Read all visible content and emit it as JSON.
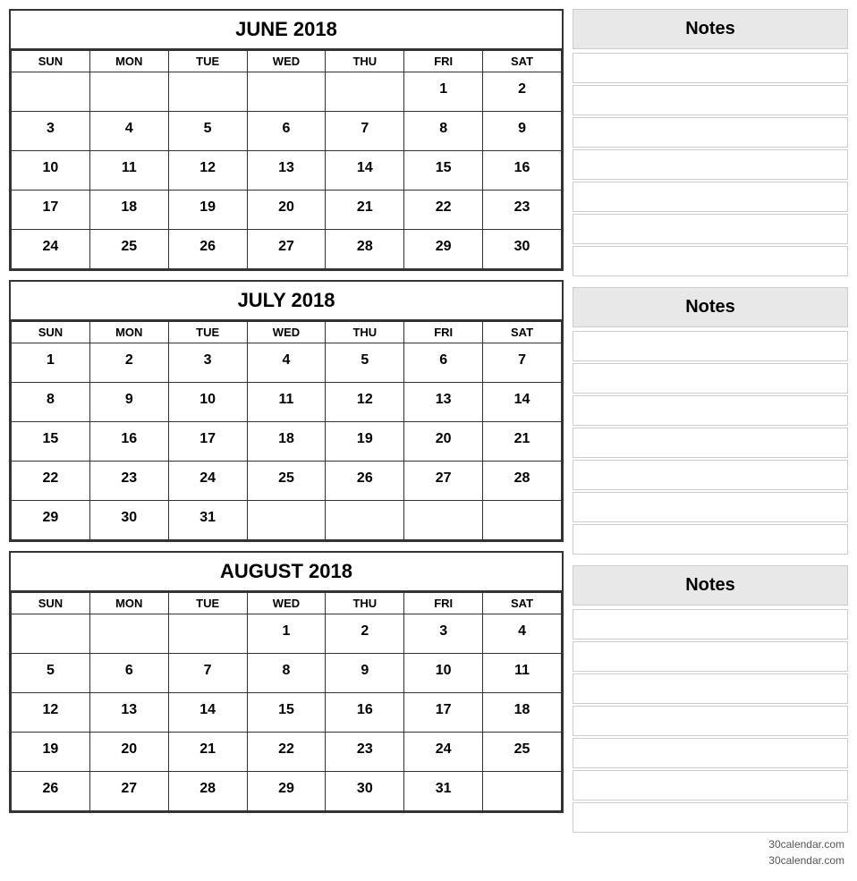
{
  "months": [
    {
      "name": "JUNE 2018",
      "days_header": [
        "SUN",
        "MON",
        "TUE",
        "WED",
        "THU",
        "FRI",
        "SAT"
      ],
      "weeks": [
        [
          "",
          "",
          "",
          "",
          "",
          "1",
          "2"
        ],
        [
          "3",
          "4",
          "5",
          "6",
          "7",
          "8",
          "9"
        ],
        [
          "10",
          "11",
          "12",
          "13",
          "14",
          "15",
          "16"
        ],
        [
          "17",
          "18",
          "19",
          "20",
          "21",
          "22",
          "23"
        ],
        [
          "24",
          "25",
          "26",
          "27",
          "28",
          "29",
          "30"
        ]
      ]
    },
    {
      "name": "JULY 2018",
      "days_header": [
        "SUN",
        "MON",
        "TUE",
        "WED",
        "THU",
        "FRI",
        "SAT"
      ],
      "weeks": [
        [
          "1",
          "2",
          "3",
          "4",
          "5",
          "6",
          "7"
        ],
        [
          "8",
          "9",
          "10",
          "11",
          "12",
          "13",
          "14"
        ],
        [
          "15",
          "16",
          "17",
          "18",
          "19",
          "20",
          "21"
        ],
        [
          "22",
          "23",
          "24",
          "25",
          "26",
          "27",
          "28"
        ],
        [
          "29",
          "30",
          "31",
          "",
          "",
          "",
          ""
        ]
      ]
    },
    {
      "name": "AUGUST 2018",
      "days_header": [
        "SUN",
        "MON",
        "TUE",
        "WED",
        "THU",
        "FRI",
        "SAT"
      ],
      "weeks": [
        [
          "",
          "",
          "",
          "1",
          "2",
          "3",
          "4"
        ],
        [
          "5",
          "6",
          "7",
          "8",
          "9",
          "10",
          "11"
        ],
        [
          "12",
          "13",
          "14",
          "15",
          "16",
          "17",
          "18"
        ],
        [
          "19",
          "20",
          "21",
          "22",
          "23",
          "24",
          "25"
        ],
        [
          "26",
          "27",
          "28",
          "29",
          "30",
          "31",
          ""
        ]
      ]
    }
  ],
  "notes_label": "Notes",
  "notes_lines_count": 7,
  "footer": "30calendar.com"
}
